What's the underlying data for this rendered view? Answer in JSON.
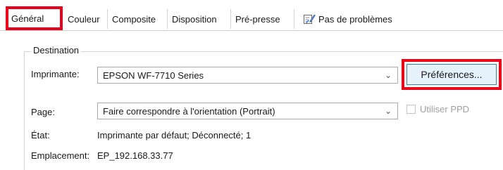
{
  "tabs": [
    {
      "label": "Général",
      "active": true
    },
    {
      "label": "Couleur",
      "active": false
    },
    {
      "label": "Composite",
      "active": false
    },
    {
      "label": "Disposition",
      "active": false
    },
    {
      "label": "Pré-presse",
      "active": false
    },
    {
      "label": "Pas de problèmes",
      "active": false,
      "icon": "checklist-pen-icon"
    }
  ],
  "destination": {
    "title": "Destination",
    "printer_label": "Imprimante:",
    "printer_value": "EPSON WF-7710 Series",
    "preferences_label": "Préférences...",
    "page_label": "Page:",
    "page_value": "Faire correspondre à l'orientation (Portrait)",
    "use_ppd_label": "Utiliser PPD",
    "use_ppd_checked": false,
    "state_label": "État:",
    "state_value": "Imprimante par défaut; Déconnecté; 1",
    "location_label": "Emplacement:",
    "location_value": "EP_192.168.33.77"
  },
  "colors": {
    "highlight": "#e8001a",
    "button_bg": "#e5f1fb",
    "button_border": "#3c7fb1"
  }
}
